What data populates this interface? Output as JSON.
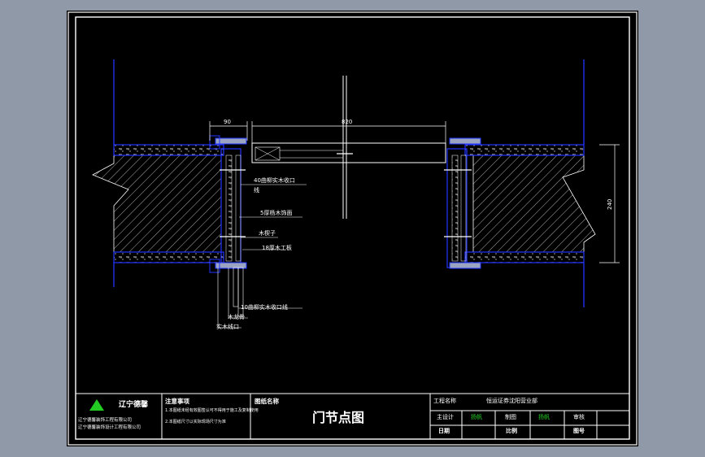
{
  "dimensions": {
    "left_width": "90",
    "opening_width": "820",
    "wall_thickness": "240"
  },
  "callouts": [
    "40曲柳实木收口",
    "线",
    "5厚杨木饰面",
    "木楔子",
    "18厚木工板",
    "10曲柳实木收口线",
    "木龙骨",
    "实木线口"
  ],
  "title_block": {
    "company_short": "辽宁德馨",
    "company_lines": [
      "辽宁德馨装饰工程有限公司",
      "辽宁德馨装饰设计工程有限公司"
    ],
    "notes_title": "注意事项",
    "notes": [
      "1.本图纸未经有效图签认可不得用于施工及复制使用",
      "2.本图纸尺寸以实际现场尺寸为准"
    ],
    "drawing_name_label": "图纸名称",
    "drawing_title": "门节点图",
    "project_name_label": "工程名称",
    "project_name": "恒运证券沈阳营业部",
    "chief_designer_label": "主设计",
    "chief_designer": "扬帆",
    "drawn_by_label": "制图",
    "drawn_by": "扬帆",
    "review_label": "审核",
    "date_label": "日期",
    "scale_label": "比例",
    "sheet_no_label": "图号"
  },
  "colors": {
    "background": "#000000",
    "frame": "#ffffff",
    "wall_outline": "#2233ff",
    "hatch": "#ffffff",
    "accent_green": "#22cc22"
  }
}
